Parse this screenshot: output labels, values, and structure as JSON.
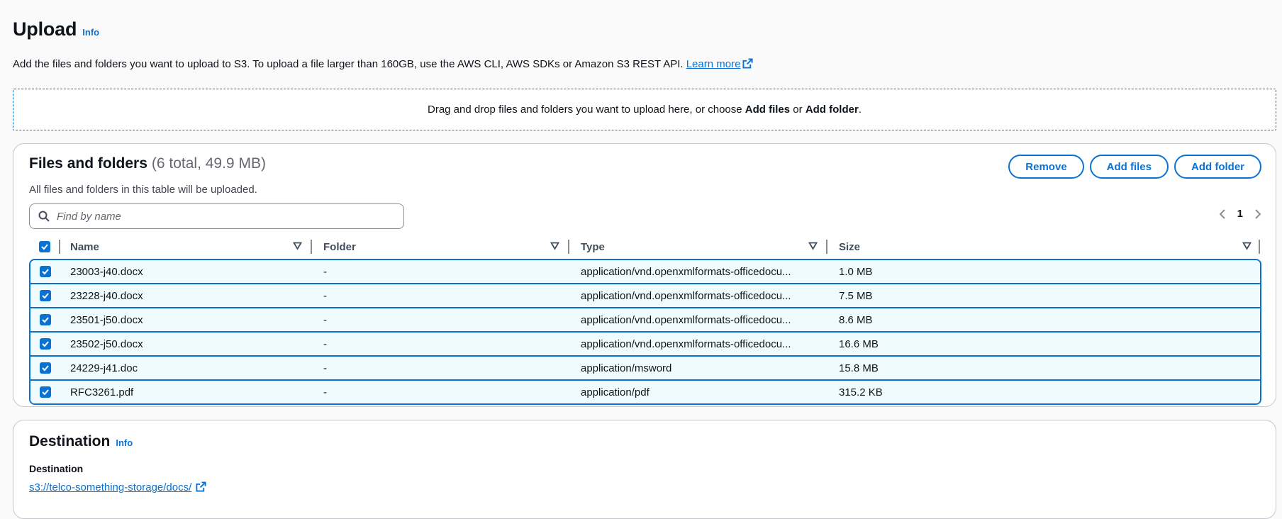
{
  "header": {
    "title": "Upload",
    "info": "Info",
    "description": "Add the files and folders you want to upload to S3. To upload a file larger than 160GB, use the AWS CLI, AWS SDKs or Amazon S3 REST API.",
    "learn_more": "Learn more"
  },
  "dropzone": {
    "text_before": "Drag and drop files and folders you want to upload here, or choose ",
    "add_files": "Add files",
    "or": " or ",
    "add_folder": "Add folder",
    "period": "."
  },
  "files_panel": {
    "title": "Files and folders",
    "counter": "(6 total, 49.9 MB)",
    "subtitle": "All files and folders in this table will be uploaded.",
    "buttons": {
      "remove": "Remove",
      "add_files": "Add files",
      "add_folder": "Add folder"
    },
    "search_placeholder": "Find by name",
    "page": "1",
    "columns": {
      "name": "Name",
      "folder": "Folder",
      "type": "Type",
      "size": "Size"
    },
    "rows": [
      {
        "name": "23003-j40.docx",
        "folder": "-",
        "type": "application/vnd.openxmlformats-officedocu...",
        "size": "1.0 MB",
        "selected": true
      },
      {
        "name": "23228-j40.docx",
        "folder": "-",
        "type": "application/vnd.openxmlformats-officedocu...",
        "size": "7.5 MB",
        "selected": true
      },
      {
        "name": "23501-j50.docx",
        "folder": "-",
        "type": "application/vnd.openxmlformats-officedocu...",
        "size": "8.6 MB",
        "selected": true
      },
      {
        "name": "23502-j50.docx",
        "folder": "-",
        "type": "application/vnd.openxmlformats-officedocu...",
        "size": "16.6 MB",
        "selected": true
      },
      {
        "name": "24229-j41.doc",
        "folder": "-",
        "type": "application/msword",
        "size": "15.8 MB",
        "selected": true
      },
      {
        "name": "RFC3261.pdf",
        "folder": "-",
        "type": "application/pdf",
        "size": "315.2 KB",
        "selected": true
      }
    ]
  },
  "destination": {
    "title": "Destination",
    "info": "Info",
    "label": "Destination",
    "link": "s3://telco-something-storage/docs/"
  },
  "colors": {
    "accent": "#0972d3",
    "row_selected_bg": "#f0fbff",
    "text": "#0f141a",
    "muted": "#656871"
  },
  "icons": {
    "external": "external-link-icon",
    "search": "search-icon",
    "sort": "sort-caret-icon",
    "check": "check-icon",
    "prev": "chevron-left-icon",
    "next": "chevron-right-icon"
  }
}
